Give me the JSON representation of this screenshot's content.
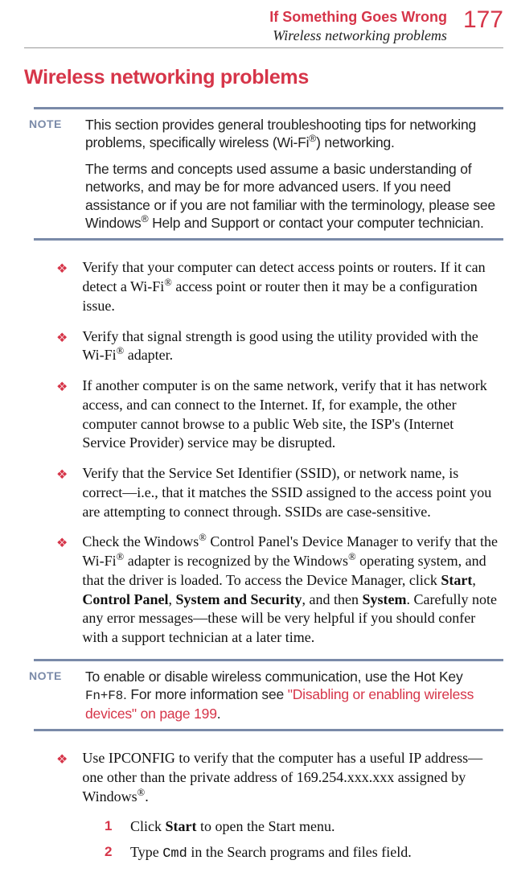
{
  "header": {
    "chapter_title": "If Something Goes Wrong",
    "section_subtitle": "Wireless networking problems",
    "page_number": "177"
  },
  "heading": "Wireless networking problems",
  "note1": {
    "label": "NOTE",
    "para1_a": "This section provides general troubleshooting tips for networking problems, specifically wireless (Wi-Fi",
    "para1_b": ") networking.",
    "para2_a": "The terms and concepts used assume a basic understanding of networks, and may be for more advanced users. If you need assistance or if you are not familiar with the terminology, please see Windows",
    "para2_b": " Help and Support or contact your computer technician."
  },
  "bullets": [
    {
      "parts": [
        {
          "t": "Verify that your computer can detect access points or routers. If it can detect a Wi-Fi"
        },
        {
          "sup": "®"
        },
        {
          "t": " access point or router then it may be a configuration issue."
        }
      ]
    },
    {
      "parts": [
        {
          "t": "Verify that signal strength is good using the utility provided with the Wi-Fi"
        },
        {
          "sup": "®"
        },
        {
          "t": " adapter."
        }
      ]
    },
    {
      "parts": [
        {
          "t": "If another computer is on the same network, verify that it has network access, and can connect to the Internet. If, for example, the other computer cannot browse to a public Web site, the ISP's (Internet Service Provider) service may be disrupted."
        }
      ]
    },
    {
      "parts": [
        {
          "t": "Verify that the Service Set Identifier (SSID), or network name, is correct—i.e., that it matches the SSID assigned to the access point you are attempting to connect through. SSIDs are case-sensitive."
        }
      ]
    },
    {
      "parts": [
        {
          "t": "Check the Windows"
        },
        {
          "sup": "®"
        },
        {
          "t": " Control Panel's Device Manager to verify that the Wi-Fi"
        },
        {
          "sup": "®"
        },
        {
          "t": " adapter is recognized by the Windows"
        },
        {
          "sup": "®"
        },
        {
          "t": " operating system, and that the driver is loaded. To access the Device Manager, click "
        },
        {
          "b": "Start"
        },
        {
          "t": ", "
        },
        {
          "b": "Control Panel"
        },
        {
          "t": ", "
        },
        {
          "b": "System and Security"
        },
        {
          "t": ", and then "
        },
        {
          "b": "System"
        },
        {
          "t": ". Carefully note any error messages—these will be very helpful if you should confer with a support technician at a later time."
        }
      ]
    }
  ],
  "note2": {
    "label": "NOTE",
    "text_a": "To enable or disable wireless communication, use the Hot Key ",
    "hotkey": "Fn+F8",
    "text_b": ". For more information see ",
    "xref": "\"Disabling or enabling wireless devices\" on page 199",
    "text_c": "."
  },
  "bullets2": [
    {
      "parts": [
        {
          "t": "Use IPCONFIG to verify that the computer has a useful IP address—one other than the private address of 169.254.xxx.xxx assigned by Windows"
        },
        {
          "sup": "®"
        },
        {
          "t": "."
        }
      ]
    }
  ],
  "steps": [
    {
      "num": "1",
      "parts": [
        {
          "t": "Click "
        },
        {
          "b": "Start"
        },
        {
          "t": " to open the Start menu."
        }
      ]
    },
    {
      "num": "2",
      "parts": [
        {
          "t": "Type "
        },
        {
          "m": "Cmd"
        },
        {
          "t": " in the Search programs and files field."
        }
      ]
    }
  ],
  "reg": "®"
}
